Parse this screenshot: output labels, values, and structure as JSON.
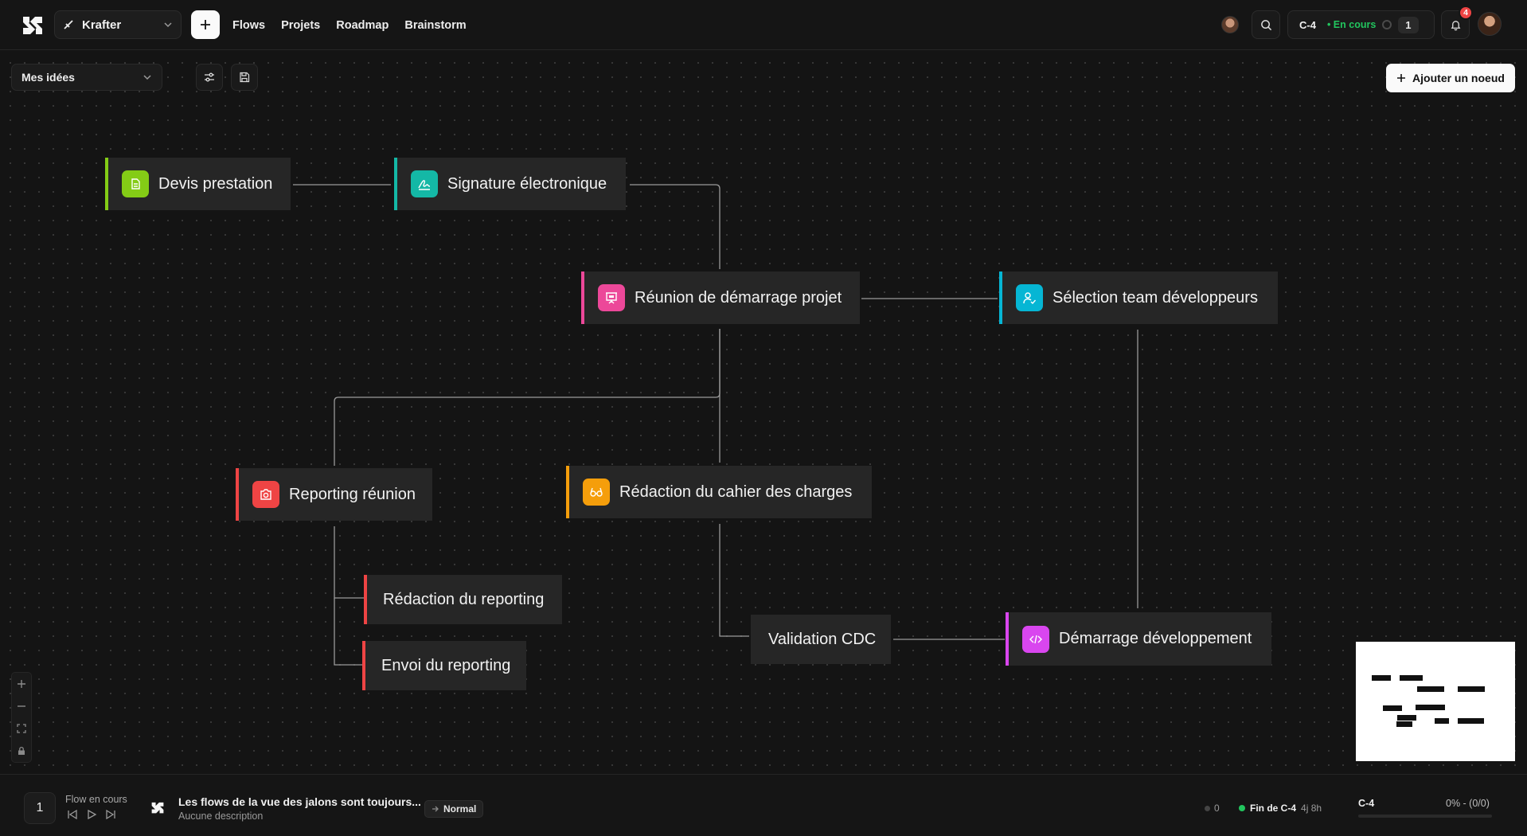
{
  "header": {
    "workspace": "Krafter",
    "nav": [
      "Flows",
      "Projets",
      "Roadmap",
      "Brainstorm"
    ],
    "cycle": "C-4",
    "cycle_status": "• En cours",
    "cycle_count": "1",
    "notification_count": "4"
  },
  "toolbar": {
    "view_label": "Mes idées",
    "add_node_label": "Ajouter un noeud"
  },
  "nodes": [
    {
      "id": "devis",
      "label": "Devis prestation",
      "icon": "file-icon",
      "color": "#84cc16"
    },
    {
      "id": "signature",
      "label": "Signature électronique",
      "icon": "signature-icon",
      "color": "#14b8a6"
    },
    {
      "id": "reunion",
      "label": "Réunion de démarrage projet",
      "icon": "presentation-icon",
      "color": "#ec4899"
    },
    {
      "id": "selection",
      "label": "Sélection team développeurs",
      "icon": "user-check-icon",
      "color": "#06b6d4"
    },
    {
      "id": "reporting",
      "label": "Reporting réunion",
      "icon": "camera-icon",
      "color": "#ef4444"
    },
    {
      "id": "redaction_cdc",
      "label": "Rédaction du cahier des charges",
      "icon": "glasses-icon",
      "color": "#f59e0b"
    },
    {
      "id": "redaction_reporting",
      "label": "Rédaction du reporting",
      "icon": "",
      "color": "#ef4444"
    },
    {
      "id": "envoi_reporting",
      "label": "Envoi du reporting",
      "icon": "",
      "color": "#ef4444"
    },
    {
      "id": "validation_cdc",
      "label": "Validation CDC",
      "icon": "",
      "color": "#3a3a3a"
    },
    {
      "id": "demarrage_dev",
      "label": "Démarrage développement",
      "icon": "code-icon",
      "color": "#d946ef"
    }
  ],
  "bottom": {
    "flow_number": "1",
    "flow_label": "Flow en cours",
    "flow_title": "Les flows de la vue des jalons sont toujours...",
    "flow_desc": "Aucune description",
    "priority": "Normal",
    "dot_count": "0",
    "end_label": "Fin de C-4",
    "end_time": "4j 8h",
    "cycle_name": "C-4",
    "cycle_progress": "0% - (0/0)",
    "progress_fraction": 0
  }
}
